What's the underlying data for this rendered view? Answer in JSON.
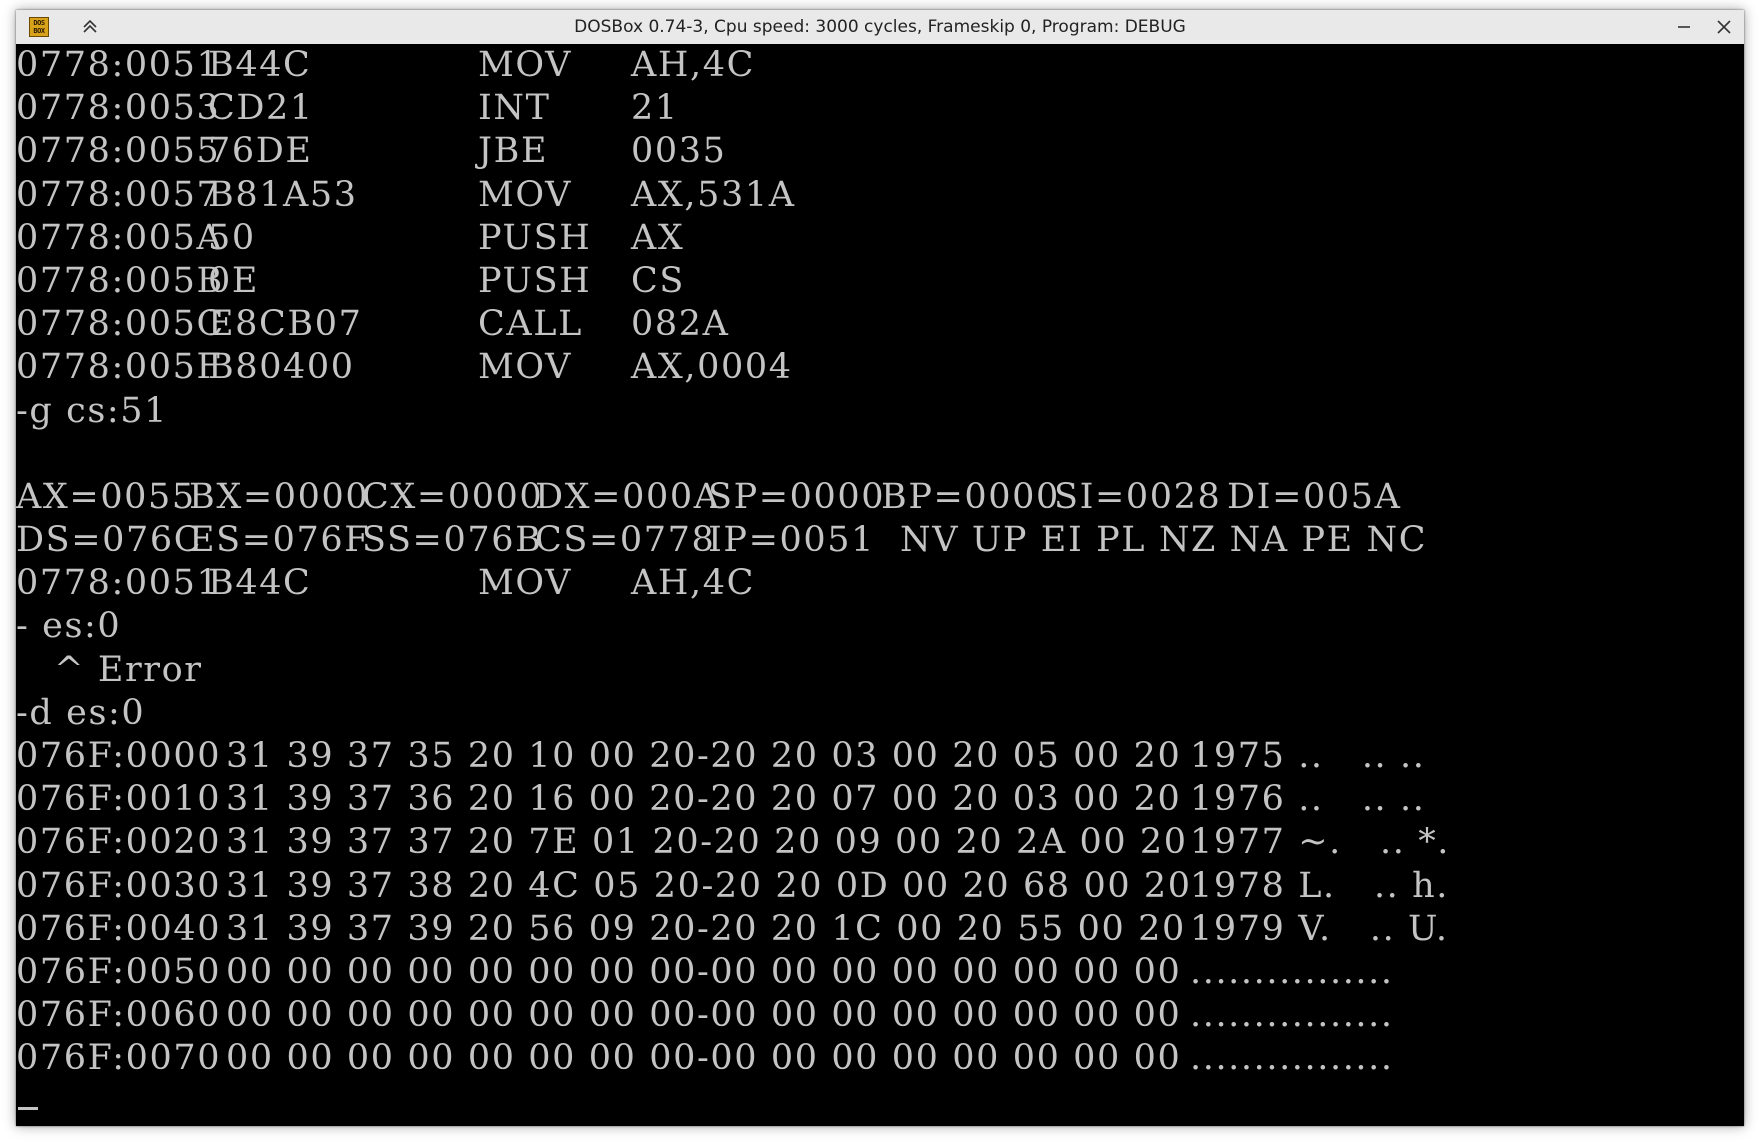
{
  "window": {
    "title": "DOSBox 0.74-3, Cpu speed: 3000 cycles, Frameskip 0, Program: DEBUG",
    "icon_name": "dosbox-icon",
    "icon_text": "DOS BOX",
    "controls": [
      "keep-above",
      "minimize",
      "close"
    ]
  },
  "colors": {
    "terminal_bg": "#000000",
    "terminal_fg": "#c4c4c4",
    "titlebar_bg": "#e9e9e9"
  },
  "terminal": {
    "disasm": [
      {
        "addr": "0778:0051",
        "bytes": "B44C",
        "mnemonic": "MOV",
        "operand": "AH,4C"
      },
      {
        "addr": "0778:0053",
        "bytes": "CD21",
        "mnemonic": "INT",
        "operand": "21"
      },
      {
        "addr": "0778:0055",
        "bytes": "76DE",
        "mnemonic": "JBE",
        "operand": "0035"
      },
      {
        "addr": "0778:0057",
        "bytes": "B81A53",
        "mnemonic": "MOV",
        "operand": "AX,531A"
      },
      {
        "addr": "0778:005A",
        "bytes": "50",
        "mnemonic": "PUSH",
        "operand": "AX"
      },
      {
        "addr": "0778:005B",
        "bytes": "0E",
        "mnemonic": "PUSH",
        "operand": "CS"
      },
      {
        "addr": "0778:005C",
        "bytes": "E8CB07",
        "mnemonic": "CALL",
        "operand": "082A"
      },
      {
        "addr": "0778:005F",
        "bytes": "B80400",
        "mnemonic": "MOV",
        "operand": "AX,0004"
      }
    ],
    "cmd_go": "-g cs:51",
    "blank": "",
    "regs1": [
      "AX=0055",
      "BX=0000",
      "CX=0000",
      "DX=000A",
      "SP=0000",
      "BP=0000",
      "SI=0028",
      "DI=005A"
    ],
    "regs2": [
      "DS=076C",
      "ES=076F",
      "SS=076B",
      "CS=0778",
      "IP=0051"
    ],
    "flags": "NV UP EI PL NZ NA PE NC",
    "current": {
      "addr": "0778:0051",
      "bytes": "B44C",
      "mnemonic": "MOV",
      "operand": "AH,4C"
    },
    "cmd_err": "- es:0",
    "error": "   ^ Error",
    "cmd_dump": "-d es:0",
    "dump": [
      {
        "addr": "076F:0000",
        "hex": "31 39 37 35 20 10 00 20-20 20 03 00 20 05 00 20",
        "ascii": "1975 ..   .. .."
      },
      {
        "addr": "076F:0010",
        "hex": "31 39 37 36 20 16 00 20-20 20 07 00 20 03 00 20",
        "ascii": "1976 ..   .. .."
      },
      {
        "addr": "076F:0020",
        "hex": "31 39 37 37 20 7E 01 20-20 20 09 00 20 2A 00 20",
        "ascii": "1977 ~.   .. *."
      },
      {
        "addr": "076F:0030",
        "hex": "31 39 37 38 20 4C 05 20-20 20 0D 00 20 68 00 20",
        "ascii": "1978 L.   .. h."
      },
      {
        "addr": "076F:0040",
        "hex": "31 39 37 39 20 56 09 20-20 20 1C 00 20 55 00 20",
        "ascii": "1979 V.   .. U."
      },
      {
        "addr": "076F:0050",
        "hex": "00 00 00 00 00 00 00 00-00 00 00 00 00 00 00 00",
        "ascii": "................"
      },
      {
        "addr": "076F:0060",
        "hex": "00 00 00 00 00 00 00 00-00 00 00 00 00 00 00 00",
        "ascii": "................"
      },
      {
        "addr": "076F:0070",
        "hex": "00 00 00 00 00 00 00 00-00 00 00 00 00 00 00 00",
        "ascii": "................"
      }
    ],
    "prompt": "-"
  }
}
